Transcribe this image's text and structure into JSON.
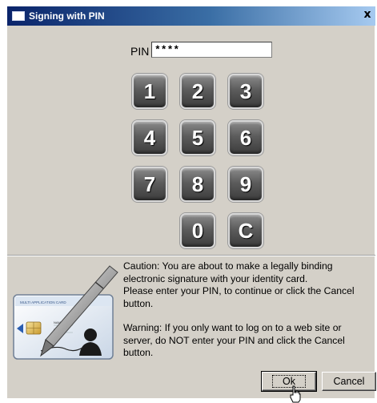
{
  "window": {
    "title": "Signing with PIN",
    "close_glyph": "x"
  },
  "pin": {
    "label": "PIN",
    "value": "****"
  },
  "keypad": {
    "keys": [
      "1",
      "2",
      "3",
      "4",
      "5",
      "6",
      "7",
      "8",
      "9",
      "0",
      "C"
    ]
  },
  "card": {
    "card_title": "MULTI APPLICATION CARD",
    "card_name": "NAME",
    "card_number": "NR."
  },
  "message": {
    "caution": "Caution: You are about to make a legally binding\nelectronic signature with your identity card.\nPlease enter your PIN, to continue or click the Cancel\nbutton.",
    "warning": "Warning: If you only want to log on to a web site or\nserver, do NOT enter your PIN and click the Cancel\nbutton."
  },
  "buttons": {
    "ok_label": "Ok",
    "cancel_label": "Cancel"
  },
  "icons": {
    "title_icon": "window-icon",
    "card_icon": "id-card-icon",
    "pen_icon": "pen-icon",
    "cursor_icon": "hand-cursor-icon"
  }
}
